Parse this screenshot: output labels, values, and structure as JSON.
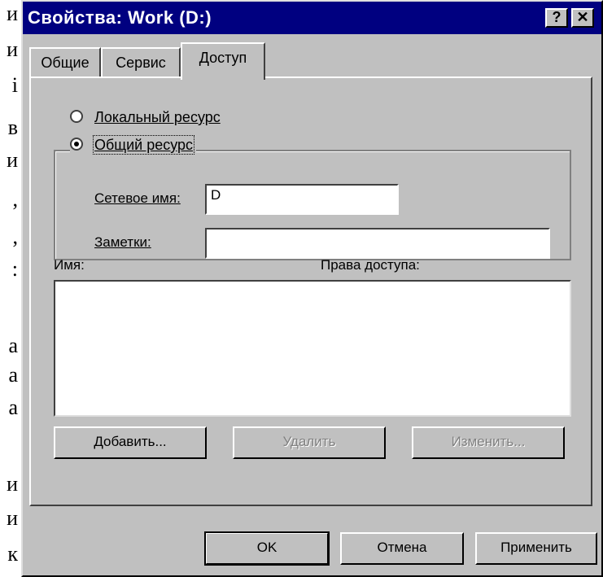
{
  "background_document": {
    "fragments": [
      "и",
      "и",
      "і",
      "в",
      "и",
      ",",
      ",",
      ":",
      "а",
      "а",
      "а",
      "и",
      "и",
      "к"
    ]
  },
  "dialog": {
    "title": "Свойства: Work (D:)",
    "help_button": "?",
    "close_button": "✕"
  },
  "tabs": [
    {
      "label": "Общие",
      "active": false
    },
    {
      "label": "Сервис",
      "active": false
    },
    {
      "label": "Доступ",
      "active": true
    }
  ],
  "sharing": {
    "local_resource_label": "Локальный ресурс",
    "shared_resource_label": "Общий ресурс",
    "selected": "shared",
    "network_name_label": "Сетевое имя:",
    "network_name_value": "D",
    "comment_label": "Заметки:",
    "comment_value": ""
  },
  "permissions": {
    "name_header": "Имя:",
    "rights_header": "Права доступа:",
    "entries": []
  },
  "list_buttons": {
    "add": "Добавить...",
    "remove": "Удалить",
    "edit": "Изменить..."
  },
  "footer_buttons": {
    "ok": "OK",
    "cancel": "Отмена",
    "apply": "Применить"
  },
  "colors": {
    "titlebar": "#000080",
    "face": "#c0c0c0"
  }
}
